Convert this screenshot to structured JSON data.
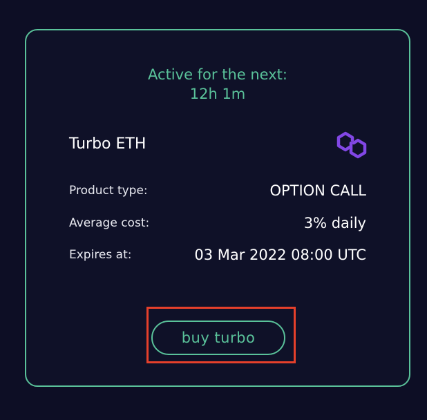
{
  "card": {
    "active_label": "Active for the next:",
    "active_value": "12h 1m",
    "product_name": "Turbo ETH",
    "network_icon": "polygon-icon",
    "rows": [
      {
        "label": "Product type:",
        "value": "OPTION CALL"
      },
      {
        "label": "Average cost:",
        "value": "3% daily"
      },
      {
        "label": "Expires at:",
        "value": "03 Mar 2022 08:00 UTC"
      }
    ],
    "buy_label": "buy turbo"
  },
  "colors": {
    "background": "#0d0e25",
    "accent": "#5ac29a",
    "polygon_purple": "#8247e5",
    "highlight": "#e5402b"
  }
}
